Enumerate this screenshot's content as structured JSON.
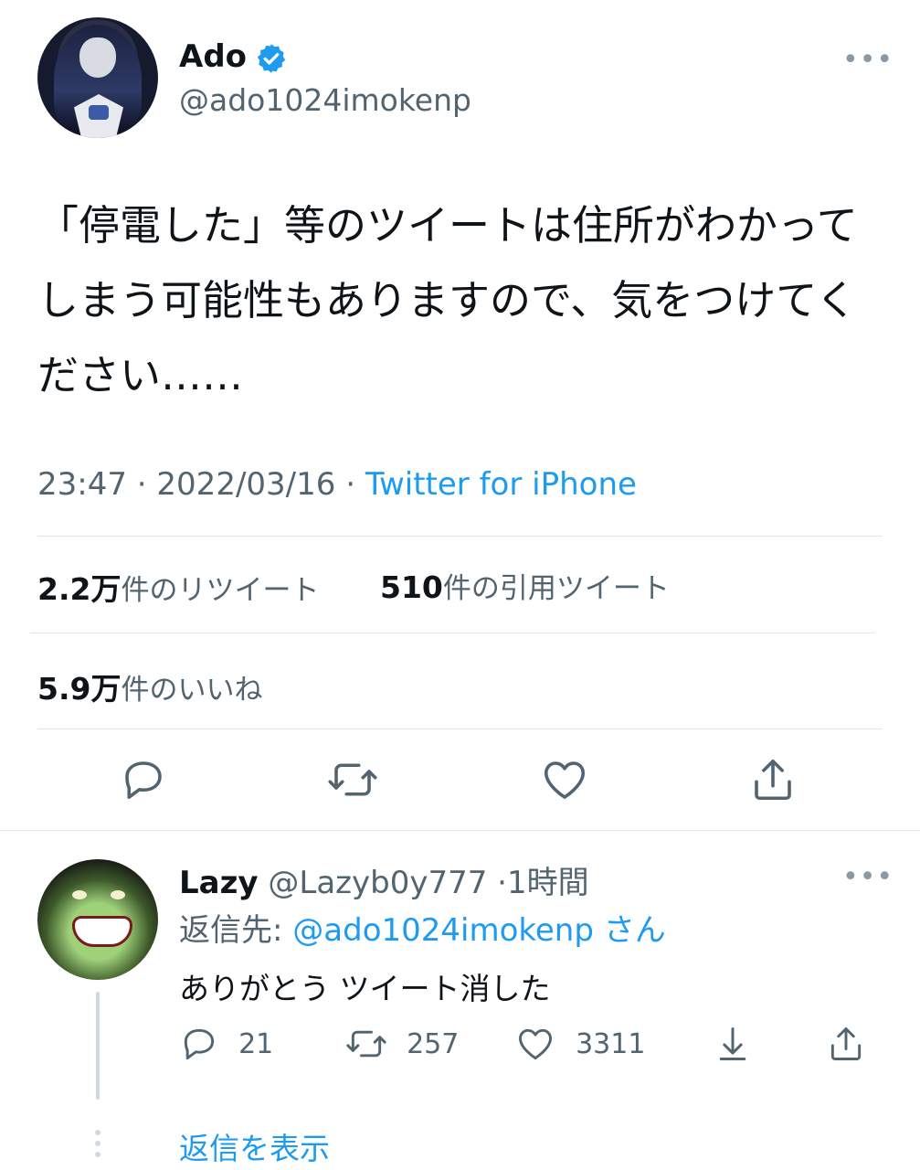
{
  "tweet": {
    "author_name": "Ado",
    "author_handle": "@ado1024imokenp",
    "more_label": "•••",
    "text": "「停電した」等のツイートは住所がわかってしまう可能性もありますので、気をつけてください……",
    "time": "23:47",
    "separator1": "·",
    "date": "2022/03/16",
    "separator2": "·",
    "source": "Twitter for iPhone",
    "retweet_count": "2.2万",
    "retweet_label": "件のリツイート",
    "quote_count": "510",
    "quote_label": "件の引用ツイート",
    "like_count": "5.9万",
    "like_label": "件のいいね",
    "verified_color": "#1d9bf0"
  },
  "actions": {
    "reply_icon": "reply-icon",
    "retweet_icon": "retweet-icon",
    "like_icon": "heart-icon",
    "share_icon": "share-icon"
  },
  "reply": {
    "author_name": "Lazy",
    "author_handle": "@Lazyb0y777",
    "separator": "·",
    "time_ago": "1時間",
    "more_label": "•••",
    "replying_to_label": "返信先:",
    "replying_to_handle": "@ado1024imokenp",
    "replying_to_suffix": "さん",
    "text": "ありがとう ツイート消した",
    "reply_count": "21",
    "retweet_count": "257",
    "like_count": "3311"
  },
  "show_replies_label": "返信を表示"
}
